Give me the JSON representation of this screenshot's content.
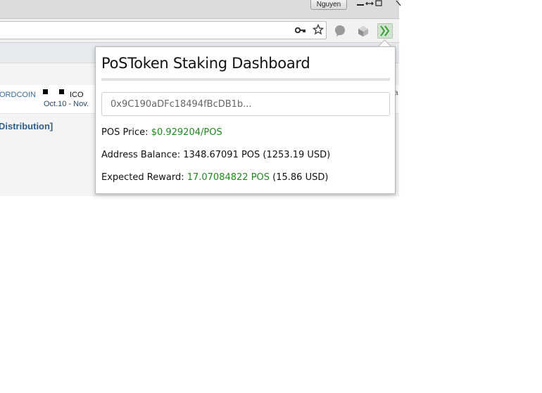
{
  "browser": {
    "profile_name": "Nguyen",
    "icons": {
      "minimize": "minimize-icon",
      "restore": "restore-icon",
      "maximize": "maximize-icon",
      "close": "close-icon",
      "key": "key-icon",
      "bookmark": "star-icon",
      "chat_extension": "chat-bubble-icon",
      "cube_extension": "cube-icon",
      "pos_extension": "chevrons-icon"
    }
  },
  "page": {
    "coin_name": "ORDCOIN",
    "ico_label": "ICO",
    "date_range": "Oct.10 - Nov.",
    "distribution_link": "Distribution]",
    "cut_text": "a"
  },
  "popup": {
    "title": "PoSToken Staking Dashboard",
    "address_value": "0x9C190aDFc18494fBcDB1b...",
    "price_label": "POS Price: ",
    "price_value": "$0.929204/POS",
    "balance_label": "Address Balance: ",
    "balance_value": "1348.67091 POS (1253.19 USD)",
    "reward_label": "Expected Reward: ",
    "reward_value": "17.07084822 POS",
    "reward_usd": " (15.86 USD)"
  },
  "colors": {
    "accent_green": "#1e8a1e",
    "link_blue": "#2f5d8a"
  }
}
